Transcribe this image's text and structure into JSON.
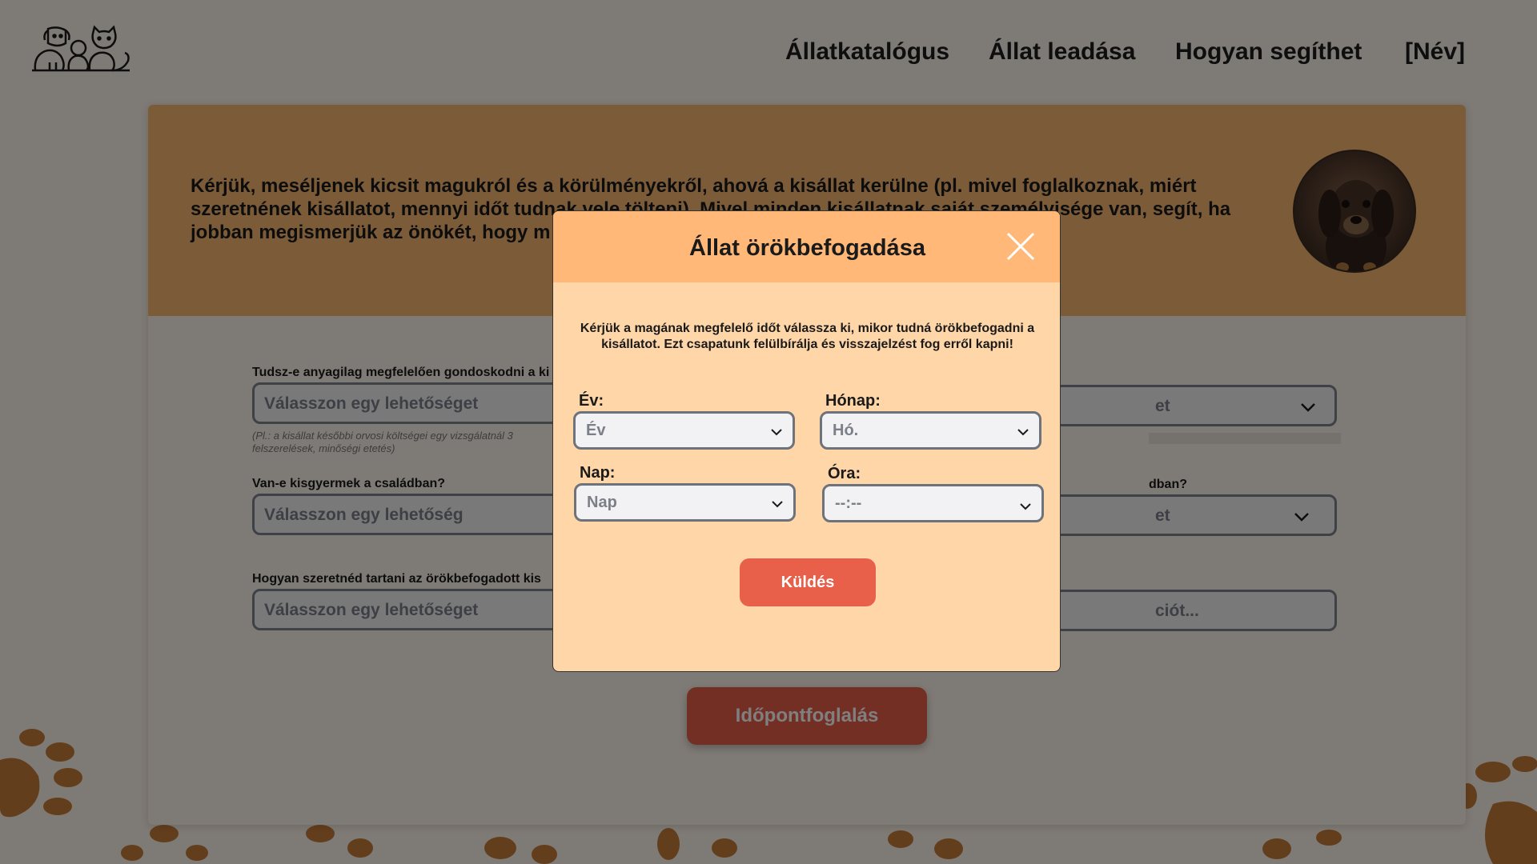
{
  "nav": {
    "catalog": "Állatkatalógus",
    "surrender": "Állat leadása",
    "help": "Hogyan segíthet",
    "user": "[Név]"
  },
  "intro": {
    "text": "Kérjük, meséljenek kicsit magukról és a körülményekről, ahová a kisállat kerülne (pl. mivel foglalkoznak, miért szeretnének kisállatot, mennyi időt tudnak vele tölteni). Mivel minden kisállatnak saját személyisége van, segít, ha jobban megismerjük az önökét, hogy m"
  },
  "form": {
    "q1_label": "Tudsz-e anyagilag megfelelően gondoskodni a ki",
    "q1_placeholder": "Válasszon egy lehetőséget",
    "q1_hint": "(Pl.: a kisállat későbbi orvosi költségei egy vizsgálatnál 3",
    "q1_hint2": "felszerelések, minőségi etetés)",
    "q2_label": "Van-e kisgyermek a családban?",
    "q2_placeholder": "Válasszon egy lehetőség",
    "q3_label": "Hogyan szeretnéd tartani az örökbefogadott kis",
    "q3_placeholder": "Válasszon egy lehetőséget",
    "r1_value": "et",
    "r2_label": "dban?",
    "r2_value": "et",
    "r3_value": "ciót..."
  },
  "booking_button": "Időpontfoglalás",
  "modal": {
    "title": "Állat örökbefogadása",
    "description": "Kérjük a magának  megfelelő időt válassza ki, mikor tudná örökbefogadni a kisállatot. Ezt  csapatunk felülbírálja és visszajelzést fog erről kapni!",
    "year_label": "Év:",
    "year_value": "Év",
    "month_label": "Hónap:",
    "month_value": "Hó.",
    "day_label": "Nap:",
    "day_value": "Nap",
    "hour_label": "Óra:",
    "hour_value": "--:--",
    "send": "Küldés"
  },
  "colors": {
    "accent": "#e85f4a",
    "intro_bg": "#f9b970",
    "modal_bg": "#ffd6a8",
    "modal_header": "#ffb877",
    "paw": "#c77d3a"
  }
}
